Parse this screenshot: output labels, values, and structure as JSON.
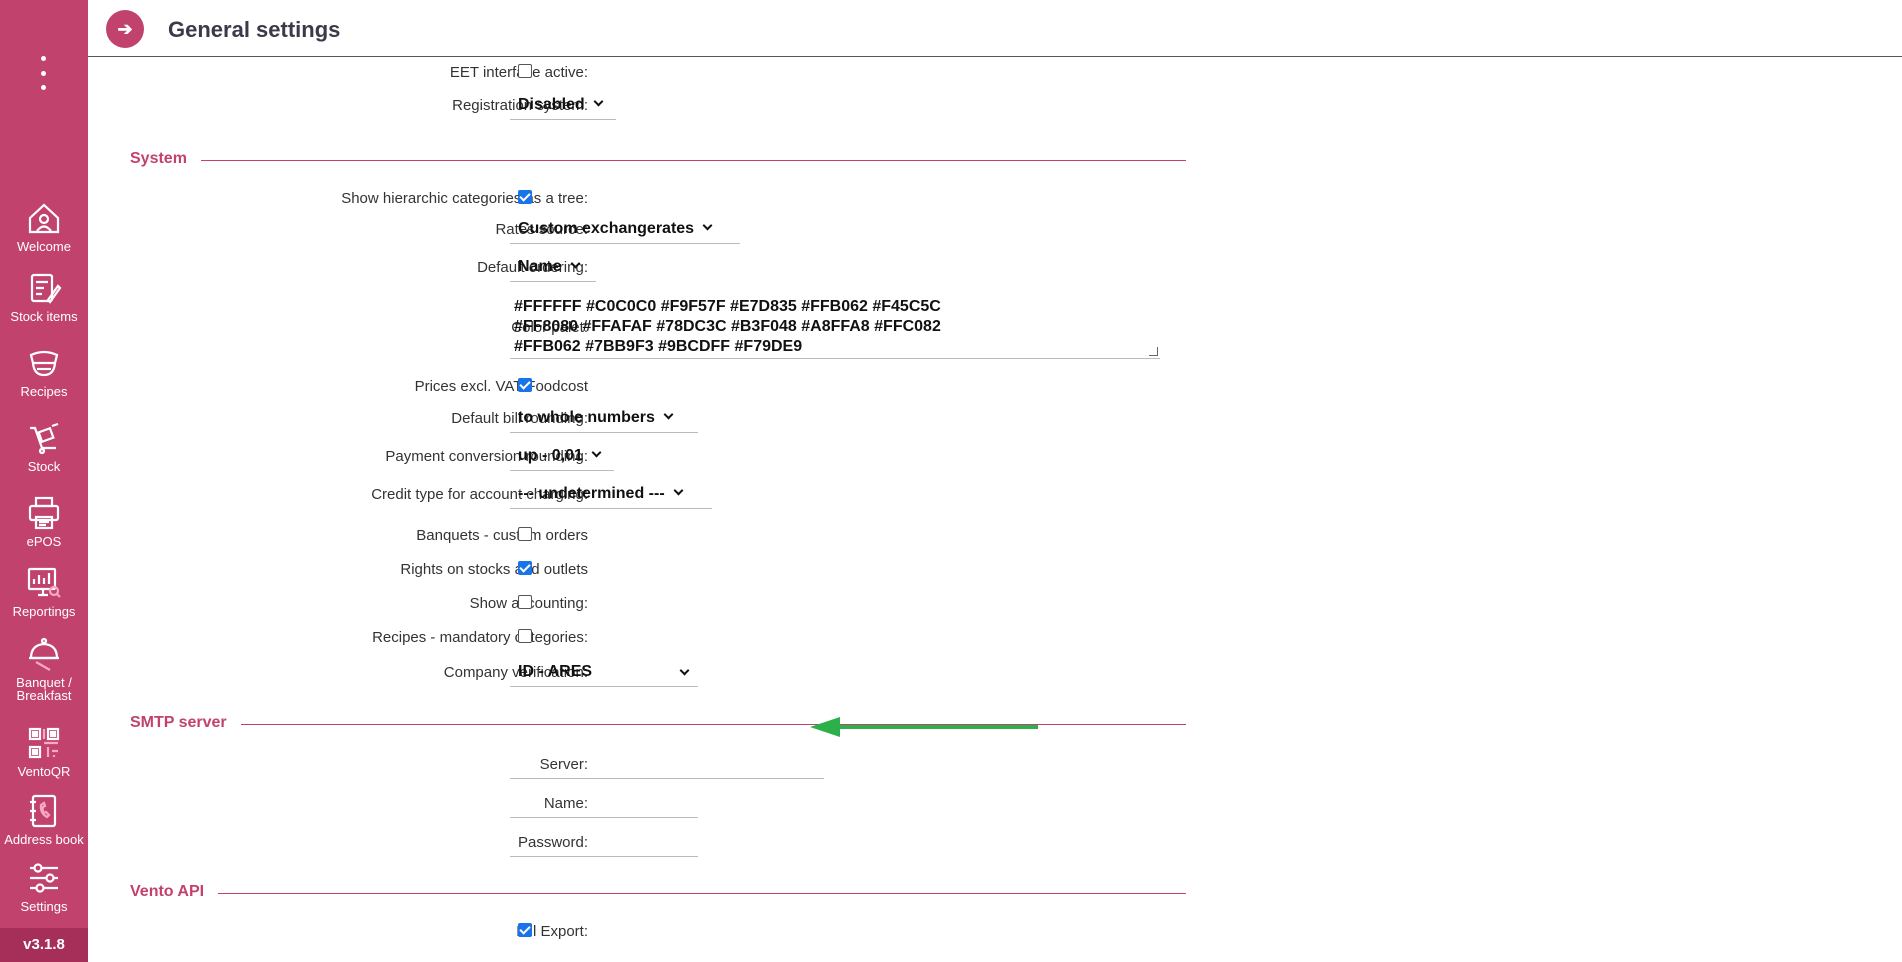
{
  "app": {
    "version": "v3.1.8",
    "colors": {
      "brand": "#c2426e",
      "checkbox": "#1a73e8",
      "arrow": "#2bb04a"
    }
  },
  "sidebar": {
    "items": [
      {
        "label": "Welcome",
        "icon": "home-icon"
      },
      {
        "label": "Stock items",
        "icon": "stock-items-icon"
      },
      {
        "label": "Recipes",
        "icon": "recipes-icon"
      },
      {
        "label": "Stock",
        "icon": "stock-icon"
      },
      {
        "label": "ePOS",
        "icon": "epos-icon"
      },
      {
        "label": "Reportings",
        "icon": "reportings-icon"
      },
      {
        "label": "Banquet /\nBreakfast",
        "label_line1": "Banquet /",
        "label_line2": "Breakfast",
        "icon": "banquet-icon"
      },
      {
        "label": "VentoQR",
        "icon": "qr-icon"
      },
      {
        "label": "Address book",
        "icon": "address-book-icon"
      },
      {
        "label": "Settings",
        "icon": "settings-icon"
      }
    ]
  },
  "header": {
    "title": "General settings",
    "back_icon": "➔"
  },
  "form": {
    "eet": {
      "label": "EET interface active:",
      "checked": false
    },
    "registration": {
      "label": "Registration system:",
      "value": "Disabled"
    },
    "system_section": "System",
    "hier_categories": {
      "label": "Show hierarchic categories as a tree:",
      "checked": true
    },
    "rates_source": {
      "label": "Rates source:",
      "value": "Custom exchangerates"
    },
    "default_ordering": {
      "label": "Default ordering:",
      "value": "Name"
    },
    "color_palet": {
      "label": "Color palet:",
      "line1": "#FFFFFF #C0C0C0 #F9F57F #E7D835 #FFB062 #F45C5C",
      "line2": "#FF8080 #FFAFAF #78DC3C #B3F048 #A8FFA8 #FFC082",
      "line3": "#FFB062 #7BB9F3 #9BCDFF #F79DE9"
    },
    "prices_excl_vat": {
      "label": "Prices excl. VAT Foodcost",
      "checked": true
    },
    "bill_rounding": {
      "label": "Default bill rounding:",
      "value": "to whole numbers"
    },
    "payment_rounding": {
      "label": "Payment conversion rounding:",
      "value": "up - 0,01"
    },
    "credit_type": {
      "label": "Credit type for account charging:",
      "value": "--- undetermined ---"
    },
    "banquets_custom": {
      "label": "Banquets - custom orders",
      "checked": false
    },
    "rights_stocks": {
      "label": "Rights on stocks and outlets",
      "checked": true
    },
    "show_accounting": {
      "label": "Show accounting:",
      "checked": false
    },
    "recipes_mandatory": {
      "label": "Recipes - mandatory categories:",
      "checked": false
    },
    "company_verification": {
      "label": "Company verification:",
      "value": "ID - ARES"
    },
    "smtp_section": "SMTP server",
    "smtp_server": {
      "label": "Server:",
      "value": ""
    },
    "smtp_name": {
      "label": "Name:",
      "value": ""
    },
    "smtp_password": {
      "label": "Password:",
      "value": ""
    },
    "api_section": "Vento API",
    "bill_export": {
      "label": "Bill Export:",
      "checked": true
    }
  }
}
